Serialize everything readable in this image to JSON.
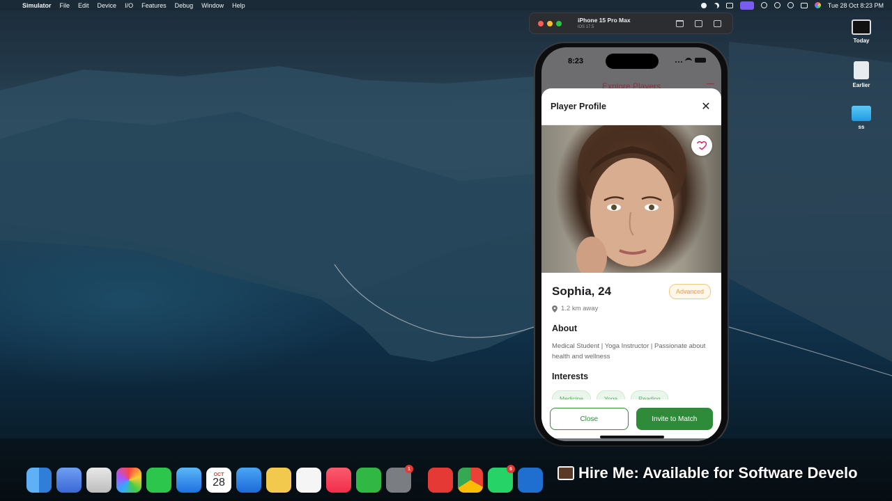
{
  "menubar": {
    "app_name": "Simulator",
    "items": [
      "File",
      "Edit",
      "Device",
      "I/O",
      "Features",
      "Debug",
      "Window",
      "Help"
    ],
    "clock": "Tue 28 Oct  8:23 PM"
  },
  "simulator": {
    "device_name": "iPhone 15 Pro Max",
    "os_version": "iOS 17.5"
  },
  "phone": {
    "status_time": "8:23",
    "background_screen_title": "Explore Players",
    "sheet": {
      "title": "Player Profile",
      "close_glyph": "✕",
      "player_name": "Sophia, 24",
      "level_badge": "Advanced",
      "distance": "1.2 km away",
      "about_heading": "About",
      "about_text": "Medical Student | Yoga Instructor | Passionate about health and wellness",
      "interests_heading": "Interests",
      "interests": [
        "Medicine",
        "Yoga",
        "Reading"
      ],
      "close_button": "Close",
      "invite_button": "Invite to Match"
    }
  },
  "desktop_icons": [
    {
      "label": "Today",
      "icon": "display-icon"
    },
    {
      "label": "Earlier",
      "icon": "document-icon"
    },
    {
      "label": "ss",
      "icon": "folder-icon"
    }
  ],
  "dock": {
    "calendar_month": "OCT",
    "calendar_day": "28",
    "badges": {
      "settings": "1",
      "whatsapp": "6"
    }
  },
  "overlay_banner": "Hire Me: Available for  Software Develo",
  "colors": {
    "accent_green": "#2e8b3a",
    "badge_orange": "#e3a23a",
    "heart_pink": "#d81b60",
    "simulator_active_menu": "#7b5cf0"
  }
}
